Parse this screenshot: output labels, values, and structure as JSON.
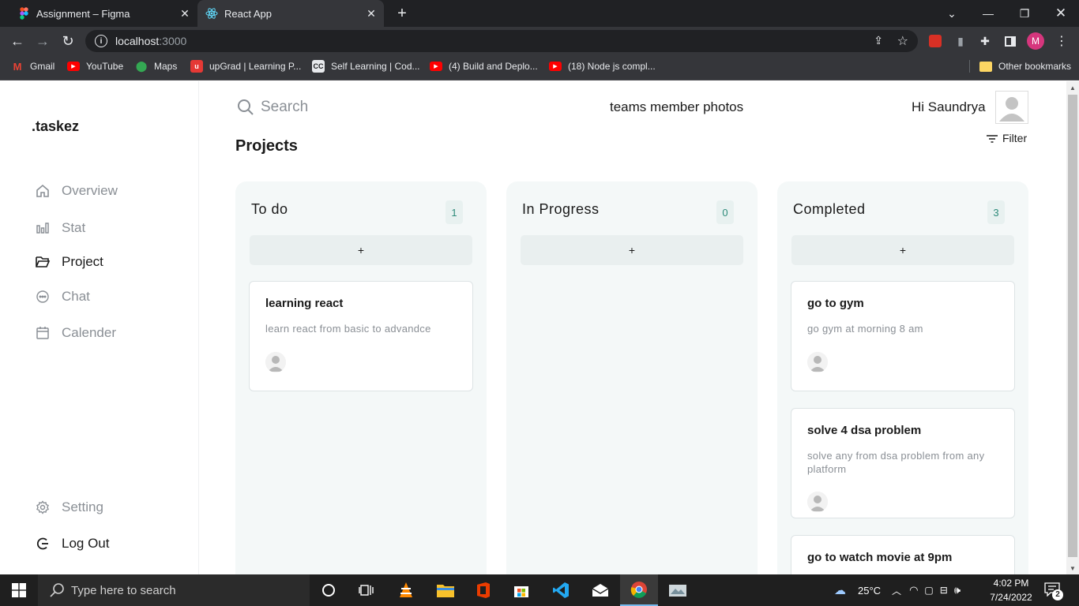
{
  "browser": {
    "tabs": [
      {
        "title": "Assignment – Figma",
        "active": false
      },
      {
        "title": "React App",
        "active": true
      }
    ],
    "url_host": "localhost",
    "url_port": ":3000",
    "bookmarks": [
      {
        "label": "Gmail",
        "icon": "gmail-icon"
      },
      {
        "label": "YouTube",
        "icon": "youtube-icon"
      },
      {
        "label": "Maps",
        "icon": "maps-icon"
      },
      {
        "label": "upGrad | Learning P...",
        "icon": "upgrad-icon"
      },
      {
        "label": "Self Learning | Cod...",
        "icon": "cc-icon"
      },
      {
        "label": "(4) Build and Deplo...",
        "icon": "youtube-icon"
      },
      {
        "label": "(18) Node js compl...",
        "icon": "youtube-icon"
      }
    ],
    "other_bookmarks": "Other bookmarks",
    "profile_initial": "M"
  },
  "sidebar": {
    "logo": ".taskez",
    "items": [
      {
        "label": "Overview",
        "icon": "home-icon"
      },
      {
        "label": "Stat",
        "icon": "bar-chart-icon"
      },
      {
        "label": "Project",
        "icon": "folder-icon"
      },
      {
        "label": "Chat",
        "icon": "chat-icon"
      },
      {
        "label": "Calender",
        "icon": "calendar-icon"
      }
    ],
    "active_index": 2,
    "bottom": [
      {
        "label": "Setting",
        "icon": "gear-icon"
      },
      {
        "label": "Log Out",
        "icon": "logout-icon"
      }
    ]
  },
  "header": {
    "search_placeholder": "Search",
    "teams_text": "teams member photos",
    "greeting": "Hi Saundrya",
    "page_title": "Projects",
    "filter_label": "Filter"
  },
  "columns": [
    {
      "title": "To do",
      "count": "1",
      "add_label": "+",
      "cards": [
        {
          "title": "learning react",
          "desc": "learn react from basic to advandce"
        }
      ]
    },
    {
      "title": "In Progress",
      "count": "0",
      "add_label": "+",
      "cards": []
    },
    {
      "title": "Completed",
      "count": "3",
      "add_label": "+",
      "cards": [
        {
          "title": "go to gym",
          "desc": "go gym at morning 8 am"
        },
        {
          "title": "solve 4 dsa problem",
          "desc": "solve any from dsa problem from any platform"
        },
        {
          "title": "go to watch movie at 9pm",
          "desc": ""
        }
      ]
    }
  ],
  "taskbar": {
    "search_placeholder": "Type here to search",
    "weather": "25°C",
    "time": "4:02 PM",
    "date": "7/24/2022",
    "notifications": "2"
  },
  "colors": {
    "accent_count": "#2e8b7a",
    "column_bg": "#f4f8f8",
    "chrome_dark": "#202124"
  }
}
